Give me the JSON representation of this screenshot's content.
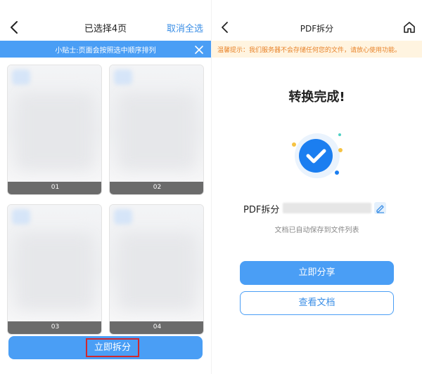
{
  "left": {
    "header": {
      "back_icon": "chevron-left-icon",
      "title": "已选择4页",
      "cancel_label": "取消全选"
    },
    "tip": {
      "text": "小贴士:页面会按照选中顺序排列",
      "close_icon": "close-icon"
    },
    "pages": [
      {
        "label": "01"
      },
      {
        "label": "02"
      },
      {
        "label": "03"
      },
      {
        "label": "04"
      }
    ],
    "split_button_label": "立即拆分"
  },
  "right": {
    "header": {
      "back_icon": "chevron-left-icon",
      "title": "PDF拆分",
      "home_icon": "home-icon"
    },
    "warning": "温馨提示：我们服务器不会存储任何您的文件，请放心使用功能。",
    "done_title": "转换完成!",
    "success_icon": "check-circle-icon",
    "file_name_prefix": "PDF拆分",
    "edit_icon": "pencil-icon",
    "saved_text": "文档已自动保存到文件列表",
    "share_label": "立即分享",
    "view_label": "查看文档"
  },
  "colors": {
    "primary": "#4a9ef5",
    "warning_text": "#e8832a",
    "warning_bg": "#fff4e0",
    "highlight": "#d0282e"
  }
}
